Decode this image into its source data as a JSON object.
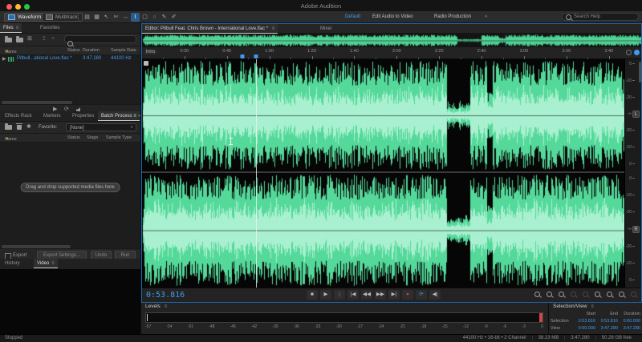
{
  "window": {
    "title": "Adobe Audition"
  },
  "toolbar": {
    "view_buttons": [
      {
        "label": "Waveform",
        "active": true
      },
      {
        "label": "Multitrack",
        "active": false
      }
    ],
    "tools": [
      {
        "name": "show-waveform-icon",
        "glyph": "▤",
        "selected": false
      },
      {
        "name": "show-spectral-icon",
        "glyph": "▦",
        "selected": false
      },
      {
        "name": "move-tool-icon",
        "glyph": "↖",
        "selected": false
      },
      {
        "name": "razor-tool-icon",
        "glyph": "✄",
        "selected": false
      },
      {
        "name": "slip-tool-icon",
        "glyph": "↔",
        "selected": false
      },
      {
        "name": "time-selection-tool-icon",
        "glyph": "I",
        "selected": true
      },
      {
        "name": "marquee-selection-tool-icon",
        "glyph": "▢",
        "selected": false
      },
      {
        "name": "lasso-selection-tool-icon",
        "glyph": "○",
        "selected": false
      },
      {
        "name": "paintbrush-tool-icon",
        "glyph": "✎",
        "selected": false
      },
      {
        "name": "spot-healing-tool-icon",
        "glyph": "✐",
        "selected": false
      }
    ],
    "workspace": {
      "active": "Default",
      "items": [
        "Edit Audio to Video",
        "Radio Production"
      ],
      "overflow": "»"
    },
    "search": {
      "placeholder": "Search Help"
    }
  },
  "files_panel": {
    "tabs": [
      {
        "label": "Files",
        "active": true
      },
      {
        "label": "Favorites",
        "active": false
      }
    ],
    "columns": {
      "name": "Name",
      "status": "Status",
      "duration": "Duration",
      "sample_rate": "Sample Rate"
    },
    "sort_icon": "▼",
    "row": {
      "disclosure": "▶",
      "name": "Pitbull...ational Love.flac *",
      "duration": "3:47.280",
      "sample_rate": "44100 Hz"
    }
  },
  "batch_panel": {
    "tabs": [
      "Effects Rack",
      "Markers",
      "Properties",
      "Batch Process"
    ],
    "active_tab": "Batch Process",
    "overflow": "»",
    "favorite_label": "Favorite:",
    "favorite_value": "[None]",
    "columns": {
      "name": "Name",
      "status": "Status",
      "stage": "Stage",
      "sample_type": "Sample Type"
    },
    "sort_icon": "▼",
    "empty_text": "Drag and drop supported media files here",
    "export_label": "Export",
    "export_settings_label": "Export Settings...",
    "undo_label": "Undo",
    "run_label": "Run"
  },
  "lower_left_tabs": [
    {
      "label": "History",
      "active": false
    },
    {
      "label": "Video",
      "active": true
    }
  ],
  "editor": {
    "tab_label": "Editor: Pitbull Feat. Chris Brown - International Love.flac *",
    "mixer_label": "Mixer",
    "ruler_unit": "hms",
    "view_duration_sec": 227.28,
    "playhead_sec": 53.816,
    "marker_sec": 47.3,
    "ticks": [
      {
        "sec": 20,
        "label": "0:20"
      },
      {
        "sec": 40,
        "label": "0:40"
      },
      {
        "sec": 60,
        "label": "1:00"
      },
      {
        "sec": 80,
        "label": "1:20"
      },
      {
        "sec": 100,
        "label": "1:40"
      },
      {
        "sec": 120,
        "label": "2:00"
      },
      {
        "sec": 140,
        "label": "2:20"
      },
      {
        "sec": 160,
        "label": "2:40"
      },
      {
        "sec": 180,
        "label": "3:00"
      },
      {
        "sec": 200,
        "label": "3:20"
      },
      {
        "sec": 220,
        "label": "3:40"
      }
    ],
    "db_labels": [
      "0",
      "-10",
      "-20",
      "-∞",
      "-20",
      "-10",
      "0"
    ],
    "channels": [
      "L",
      "R"
    ]
  },
  "transport": {
    "time": "0:53.816",
    "buttons": [
      {
        "name": "stop-button",
        "glyph": "■"
      },
      {
        "name": "play-button",
        "glyph": "▶"
      },
      {
        "name": "pause-button",
        "glyph": "||",
        "dim": true
      },
      {
        "name": "skip-to-start-button",
        "glyph": "|◀"
      },
      {
        "name": "rewind-button",
        "glyph": "◀◀"
      },
      {
        "name": "fast-forward-button",
        "glyph": "▶▶"
      },
      {
        "name": "skip-to-end-button",
        "glyph": "▶|"
      },
      {
        "name": "record-button",
        "glyph": "●",
        "color": "#cf4444"
      },
      {
        "name": "loop-playback-button",
        "glyph": "⟳",
        "color": "#3f9bf0"
      },
      {
        "name": "skip-to-cursor-button",
        "glyph": "◀|"
      }
    ],
    "zoom_buttons": [
      {
        "name": "zoom-in-button",
        "dim": false
      },
      {
        "name": "zoom-out-button",
        "dim": false
      },
      {
        "name": "zoom-full-button",
        "dim": false
      },
      {
        "name": "zoom-in-vertical-button",
        "dim": true
      },
      {
        "name": "zoom-out-vertical-button",
        "dim": true
      },
      {
        "name": "zoom-in-point-button",
        "dim": false
      },
      {
        "name": "zoom-out-point-button",
        "dim": false
      },
      {
        "name": "zoom-selection-button",
        "dim": false
      },
      {
        "name": "zoom-reset-button",
        "dim": true
      }
    ]
  },
  "levels": {
    "title": "Levels",
    "scale": [
      "-57",
      "-54",
      "-51",
      "-48",
      "-45",
      "-42",
      "-39",
      "-36",
      "-33",
      "-30",
      "-27",
      "-24",
      "-21",
      "-18",
      "-15",
      "-12",
      "-9",
      "-6",
      "-3",
      "0"
    ]
  },
  "selection_view": {
    "title": "Selection/View",
    "columns": [
      "Start",
      "End",
      "Duration"
    ],
    "rows": [
      {
        "label": "Selection",
        "start": "0:53.816",
        "end": "0:53.816",
        "duration": "0:00.000"
      },
      {
        "label": "View",
        "start": "0:00.000",
        "end": "3:47.280",
        "duration": "3:47.280"
      }
    ]
  },
  "status_bar": {
    "left": "Stopped",
    "items": [
      "44100 Hz • 16-bit • 2 Channel",
      "38.23 MB",
      "3:47.280",
      "50.28 GB free"
    ]
  },
  "colors": {
    "accent": "#3f9bf0",
    "waveform": "#54d99a",
    "waveform_bright": "#a9f0d0",
    "overview_waveform": "#4cce90",
    "record": "#cf4444",
    "clip": "#d04545",
    "traffic_lights": [
      "#ff5f57",
      "#febc2e",
      "#28c840"
    ]
  }
}
